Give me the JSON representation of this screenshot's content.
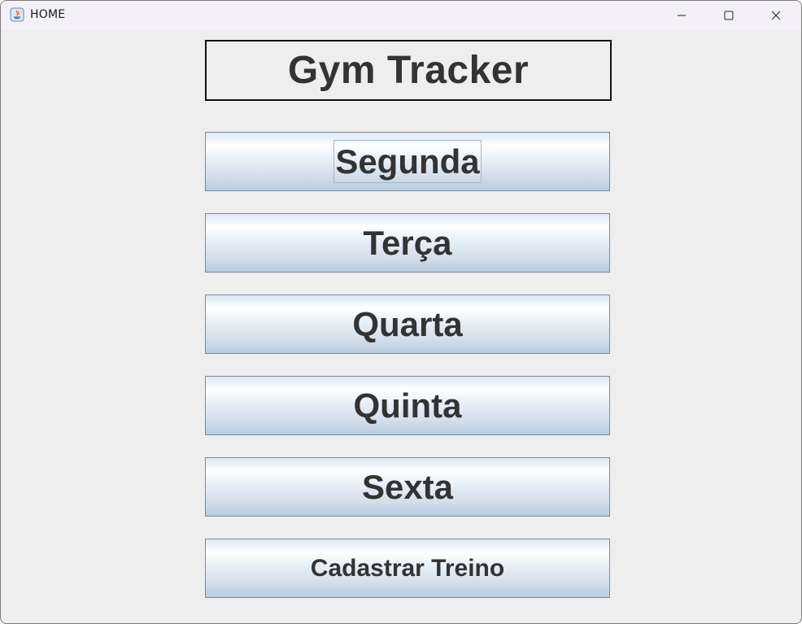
{
  "window": {
    "title": "HOME",
    "icon": "java-app-icon",
    "controls": {
      "minimize": "minimize-icon",
      "maximize": "maximize-icon",
      "close": "close-icon"
    }
  },
  "main": {
    "heading": "Gym Tracker",
    "buttons": [
      {
        "label": "Segunda",
        "focused": true
      },
      {
        "label": "Terça",
        "focused": false
      },
      {
        "label": "Quarta",
        "focused": false
      },
      {
        "label": "Quinta",
        "focused": false
      },
      {
        "label": "Sexta",
        "focused": false
      },
      {
        "label": "Cadastrar Treino",
        "focused": false
      }
    ]
  },
  "colors": {
    "window_background": "#eeeeee",
    "titlebar_background": "#f3f1f7",
    "text": "#333333",
    "button_border": "#7a8a99"
  }
}
